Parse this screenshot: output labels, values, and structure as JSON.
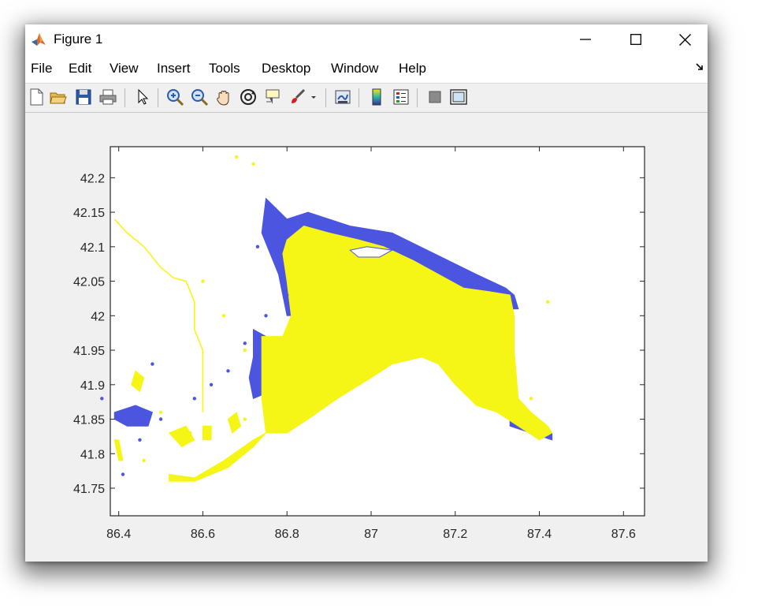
{
  "window": {
    "title": "Figure 1",
    "icon": "matlab-logo-icon"
  },
  "menu": {
    "items": [
      "File",
      "Edit",
      "View",
      "Insert",
      "Tools",
      "Desktop",
      "Window",
      "Help"
    ],
    "overflow_icon": "dock-arrow-icon"
  },
  "toolbar": {
    "buttons": [
      "new-figure-icon",
      "open-file-icon",
      "save-icon",
      "print-icon",
      "pointer-icon",
      "zoom-in-icon",
      "zoom-out-icon",
      "pan-hand-icon",
      "rotate-3d-icon",
      "data-cursor-icon",
      "brush-icon",
      "link-plot-icon",
      "colorbar-icon",
      "legend-icon",
      "hide-plot-tools-icon",
      "show-plot-tools-icon"
    ]
  },
  "chart_data": {
    "type": "heatmap",
    "title": "",
    "xlabel": "",
    "ylabel": "",
    "xlim": [
      86.38,
      87.65
    ],
    "ylim": [
      41.71,
      42.245
    ],
    "xticks": [
      "86.4",
      "86.6",
      "86.8",
      "87",
      "87.2",
      "87.4",
      "87.6"
    ],
    "yticks": [
      "41.75",
      "41.8",
      "41.85",
      "41.9",
      "41.95",
      "42",
      "42.05",
      "42.1",
      "42.15",
      "42.2"
    ],
    "xtick_values": [
      86.4,
      86.6,
      86.8,
      87.0,
      87.2,
      87.4,
      87.6
    ],
    "ytick_values": [
      41.75,
      41.8,
      41.85,
      41.9,
      41.95,
      42.0,
      42.05,
      42.1,
      42.15,
      42.2
    ],
    "grid": false,
    "colors": {
      "class_a": "#f5f516",
      "class_b": "#4b55e0",
      "background": "#ffffff"
    },
    "regions": [
      {
        "class": "class_b",
        "points": [
          [
            86.75,
            42.17
          ],
          [
            86.8,
            42.14
          ],
          [
            86.85,
            42.15
          ],
          [
            86.95,
            42.13
          ],
          [
            87.05,
            42.12
          ],
          [
            87.15,
            42.09
          ],
          [
            87.25,
            42.06
          ],
          [
            87.32,
            42.04
          ],
          [
            87.34,
            42.03
          ],
          [
            87.35,
            42.01
          ],
          [
            86.8,
            42.0
          ],
          [
            86.78,
            42.06
          ],
          [
            86.74,
            42.12
          ]
        ]
      },
      {
        "class": "class_b",
        "points": [
          [
            86.72,
            41.98
          ],
          [
            86.75,
            41.97
          ],
          [
            86.76,
            41.89
          ],
          [
            86.72,
            41.88
          ],
          [
            86.71,
            41.91
          ],
          [
            86.72,
            41.94
          ]
        ]
      },
      {
        "class": "class_b",
        "points": [
          [
            86.39,
            41.86
          ],
          [
            86.44,
            41.87
          ],
          [
            86.48,
            41.86
          ],
          [
            86.47,
            41.84
          ],
          [
            86.42,
            41.84
          ],
          [
            86.39,
            41.85
          ]
        ]
      },
      {
        "class": "class_b",
        "points": [
          [
            87.33,
            41.85
          ],
          [
            87.38,
            41.84
          ],
          [
            87.43,
            41.83
          ],
          [
            87.43,
            41.82
          ],
          [
            87.38,
            41.83
          ],
          [
            87.33,
            41.84
          ]
        ]
      },
      {
        "class": "class_a",
        "points": [
          [
            86.8,
            42.11
          ],
          [
            86.84,
            42.13
          ],
          [
            86.9,
            42.12
          ],
          [
            86.97,
            42.11
          ],
          [
            87.03,
            42.1
          ],
          [
            87.1,
            42.08
          ],
          [
            87.16,
            42.06
          ],
          [
            87.22,
            42.04
          ],
          [
            87.28,
            42.035
          ],
          [
            87.33,
            42.03
          ],
          [
            87.34,
            42.0
          ],
          [
            87.34,
            41.95
          ],
          [
            87.35,
            41.88
          ],
          [
            87.38,
            41.86
          ],
          [
            87.42,
            41.84
          ],
          [
            87.43,
            41.83
          ],
          [
            87.4,
            41.82
          ],
          [
            87.35,
            41.84
          ],
          [
            87.3,
            41.86
          ],
          [
            87.25,
            41.87
          ],
          [
            87.2,
            41.9
          ],
          [
            87.16,
            41.93
          ],
          [
            87.12,
            41.94
          ],
          [
            87.05,
            41.93
          ],
          [
            87.0,
            41.91
          ],
          [
            86.92,
            41.88
          ],
          [
            86.85,
            41.85
          ],
          [
            86.8,
            41.83
          ],
          [
            86.75,
            41.83
          ],
          [
            86.74,
            41.88
          ],
          [
            86.74,
            41.94
          ],
          [
            86.74,
            41.97
          ],
          [
            86.79,
            41.97
          ],
          [
            86.81,
            42.0
          ],
          [
            86.8,
            42.05
          ],
          [
            86.79,
            42.09
          ]
        ]
      },
      {
        "class": "class_a",
        "points": [
          [
            86.44,
            41.92
          ],
          [
            86.46,
            41.91
          ],
          [
            86.45,
            41.89
          ],
          [
            86.43,
            41.9
          ]
        ]
      },
      {
        "class": "class_a",
        "points": [
          [
            86.52,
            41.77
          ],
          [
            86.58,
            41.765
          ],
          [
            86.65,
            41.79
          ],
          [
            86.72,
            41.82
          ],
          [
            86.75,
            41.83
          ],
          [
            86.72,
            41.81
          ],
          [
            86.66,
            41.78
          ],
          [
            86.58,
            41.76
          ],
          [
            86.52,
            41.76
          ]
        ]
      },
      {
        "class": "class_a",
        "points": [
          [
            86.39,
            41.82
          ],
          [
            86.4,
            41.82
          ],
          [
            86.41,
            41.79
          ],
          [
            86.4,
            41.79
          ]
        ]
      },
      {
        "class": "class_a",
        "points": [
          [
            86.52,
            41.83
          ],
          [
            86.56,
            41.84
          ],
          [
            86.58,
            41.82
          ],
          [
            86.55,
            41.81
          ]
        ]
      },
      {
        "class": "class_a",
        "points": [
          [
            86.6,
            41.84
          ],
          [
            86.62,
            41.84
          ],
          [
            86.62,
            41.82
          ],
          [
            86.6,
            41.82
          ]
        ]
      },
      {
        "class": "class_a",
        "points": [
          [
            86.66,
            41.85
          ],
          [
            86.68,
            41.86
          ],
          [
            86.69,
            41.84
          ],
          [
            86.67,
            41.83
          ]
        ]
      }
    ],
    "holes": [
      {
        "points": [
          [
            86.95,
            42.095
          ],
          [
            86.99,
            42.1
          ],
          [
            87.05,
            42.095
          ],
          [
            87.02,
            42.085
          ],
          [
            86.97,
            42.085
          ]
        ]
      }
    ],
    "lines": [
      {
        "class": "class_a",
        "points": [
          [
            86.39,
            42.14
          ],
          [
            86.42,
            42.12
          ],
          [
            86.46,
            42.1
          ],
          [
            86.5,
            42.07
          ],
          [
            86.53,
            42.055
          ],
          [
            86.56,
            42.05
          ],
          [
            86.58,
            42.02
          ],
          [
            86.58,
            41.98
          ],
          [
            86.6,
            41.95
          ],
          [
            86.6,
            41.9
          ],
          [
            86.6,
            41.86
          ]
        ]
      }
    ],
    "speckles": [
      {
        "class": "class_b",
        "points": [
          [
            86.73,
            42.1
          ],
          [
            86.75,
            42.0
          ],
          [
            86.7,
            41.96
          ],
          [
            86.66,
            41.92
          ],
          [
            86.62,
            41.9
          ],
          [
            86.58,
            41.88
          ],
          [
            86.5,
            41.85
          ],
          [
            86.45,
            41.82
          ],
          [
            86.41,
            41.77
          ],
          [
            86.48,
            41.93
          ],
          [
            86.36,
            41.88
          ],
          [
            86.8,
            42.03
          ]
        ]
      },
      {
        "class": "class_a",
        "points": [
          [
            86.6,
            42.05
          ],
          [
            86.65,
            42.0
          ],
          [
            86.7,
            41.95
          ],
          [
            86.5,
            41.86
          ],
          [
            86.46,
            41.79
          ],
          [
            86.57,
            41.83
          ],
          [
            86.7,
            41.85
          ],
          [
            87.42,
            42.02
          ],
          [
            86.68,
            42.23
          ],
          [
            86.72,
            42.22
          ],
          [
            87.3,
            41.97
          ],
          [
            87.38,
            41.88
          ]
        ]
      }
    ]
  }
}
